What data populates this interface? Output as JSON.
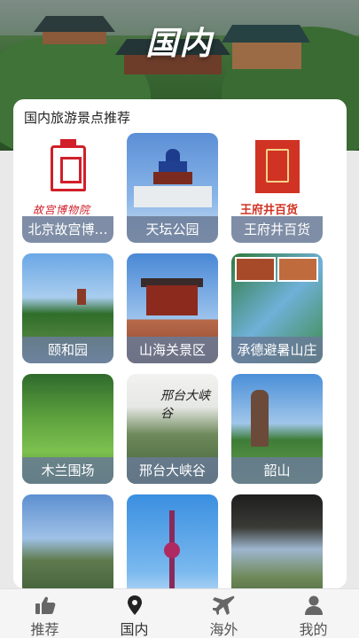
{
  "hero": {
    "title": "国内"
  },
  "section": {
    "title": "国内旅游景点推荐"
  },
  "attractions": [
    {
      "name": "北京故宫博…",
      "logo_text": "故宫博物院"
    },
    {
      "name": "天坛公园"
    },
    {
      "name": "王府井百货",
      "logo_text": "王府井百货"
    },
    {
      "name": "颐和园"
    },
    {
      "name": "山海关景区"
    },
    {
      "name": "承德避暑山庄"
    },
    {
      "name": "木兰围场"
    },
    {
      "name": "邢台大峡谷",
      "logo_text": "邢台大峡谷"
    },
    {
      "name": "韶山"
    },
    {
      "name": ""
    },
    {
      "name": ""
    },
    {
      "name": ""
    }
  ],
  "tabs": [
    {
      "label": "推荐",
      "icon": "thumbs-up-icon"
    },
    {
      "label": "国内",
      "icon": "location-pin-icon",
      "active": true
    },
    {
      "label": "海外",
      "icon": "airplane-icon"
    },
    {
      "label": "我的",
      "icon": "person-icon"
    }
  ],
  "colors": {
    "label_bg": "#697a96",
    "accent_red": "#d0202a",
    "tab_bg": "#f5f5f5"
  }
}
